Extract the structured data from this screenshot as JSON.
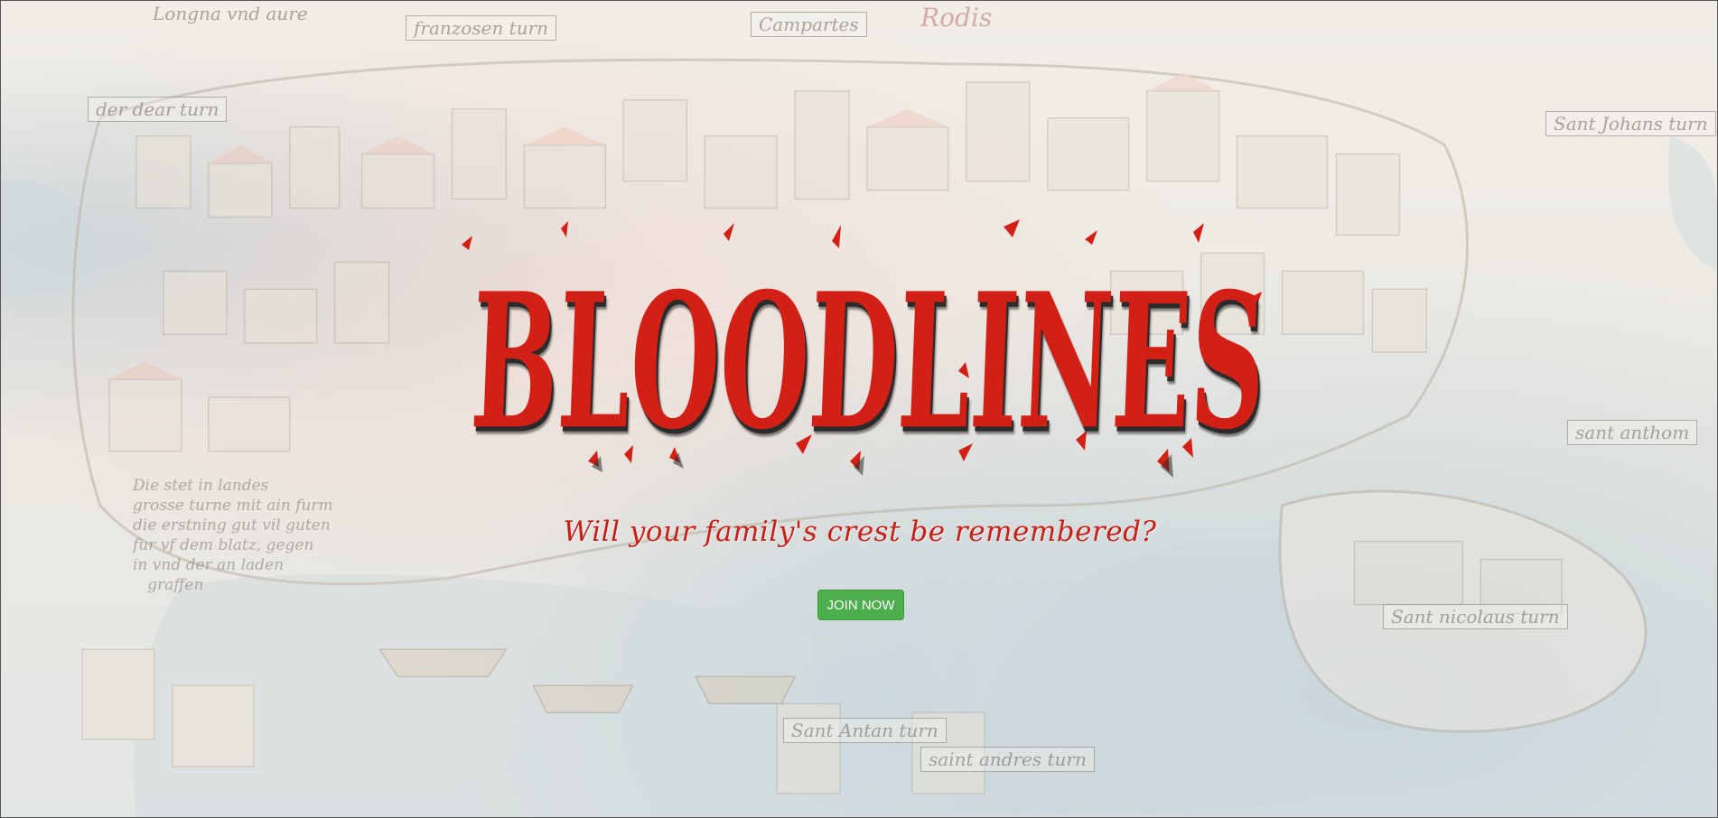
{
  "hero": {
    "title": "BLOODLINES",
    "tagline": "Will your family's crest be remembered?",
    "cta_label": "JOIN NOW"
  },
  "background": {
    "description_labels": [
      "Longna vnd aure",
      "franzosen turn",
      "Campartes",
      "Rodis",
      "der dear turn",
      "Sant Johans turn",
      "sant anthom",
      "Sant nicolaus turn",
      "saint andres turn",
      "Sant Antan turn"
    ],
    "text_block": "Die stet in landes\ngrosse turne mit ain furm\ndie erstning gut vil guten\nfur vf dem blatz, gegen\nin vnd der an laden\n   graffen"
  },
  "colors": {
    "title_red": "#d32016",
    "tagline_red": "#c81f17",
    "button_green": "#4cae4c",
    "background": "#eeece6"
  }
}
